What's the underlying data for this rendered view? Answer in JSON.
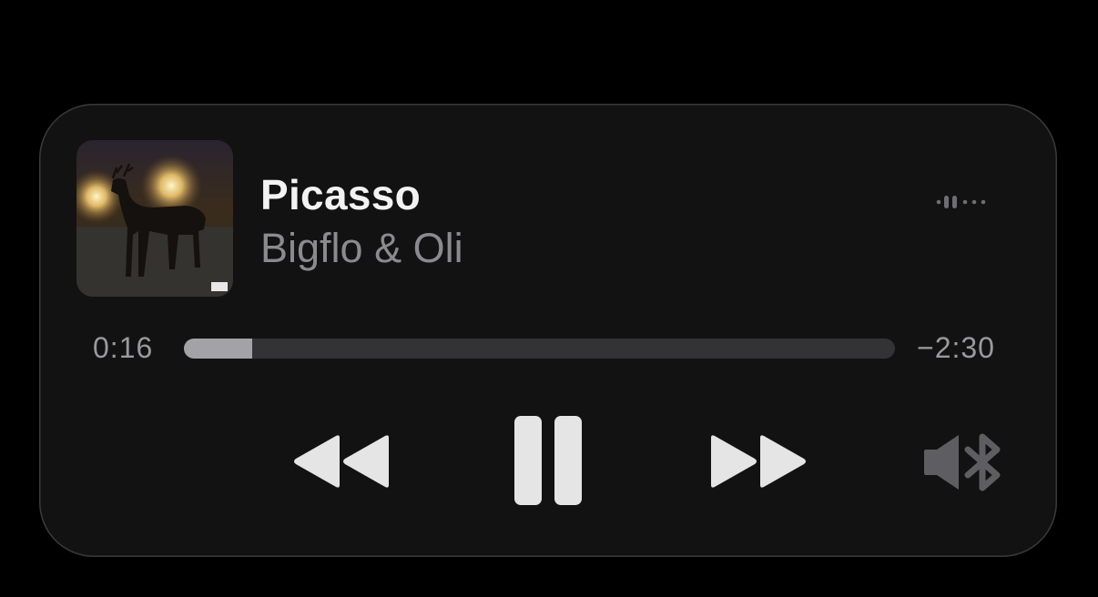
{
  "now_playing": {
    "title": "Picasso",
    "artist": "Bigflo & Oli",
    "artwork": "album-artwork-deer-in-headlights",
    "progress": 0.096
  },
  "timeline": {
    "elapsed": "0:16",
    "remaining": "−2:30"
  },
  "controls": {
    "rewind": "rewind-icon",
    "pause": "pause-icon",
    "forward": "fast-forward-icon",
    "audio_output": "speaker-bluetooth-icon",
    "more": "airplay-dots-icon"
  },
  "colors": {
    "background": "#000000",
    "card": "#121212",
    "title": "#f2f2f2",
    "secondary": "#8b8b8f",
    "track": "#333336",
    "track_fill": "#a3a3a7",
    "controls": "#e5e5e5"
  }
}
